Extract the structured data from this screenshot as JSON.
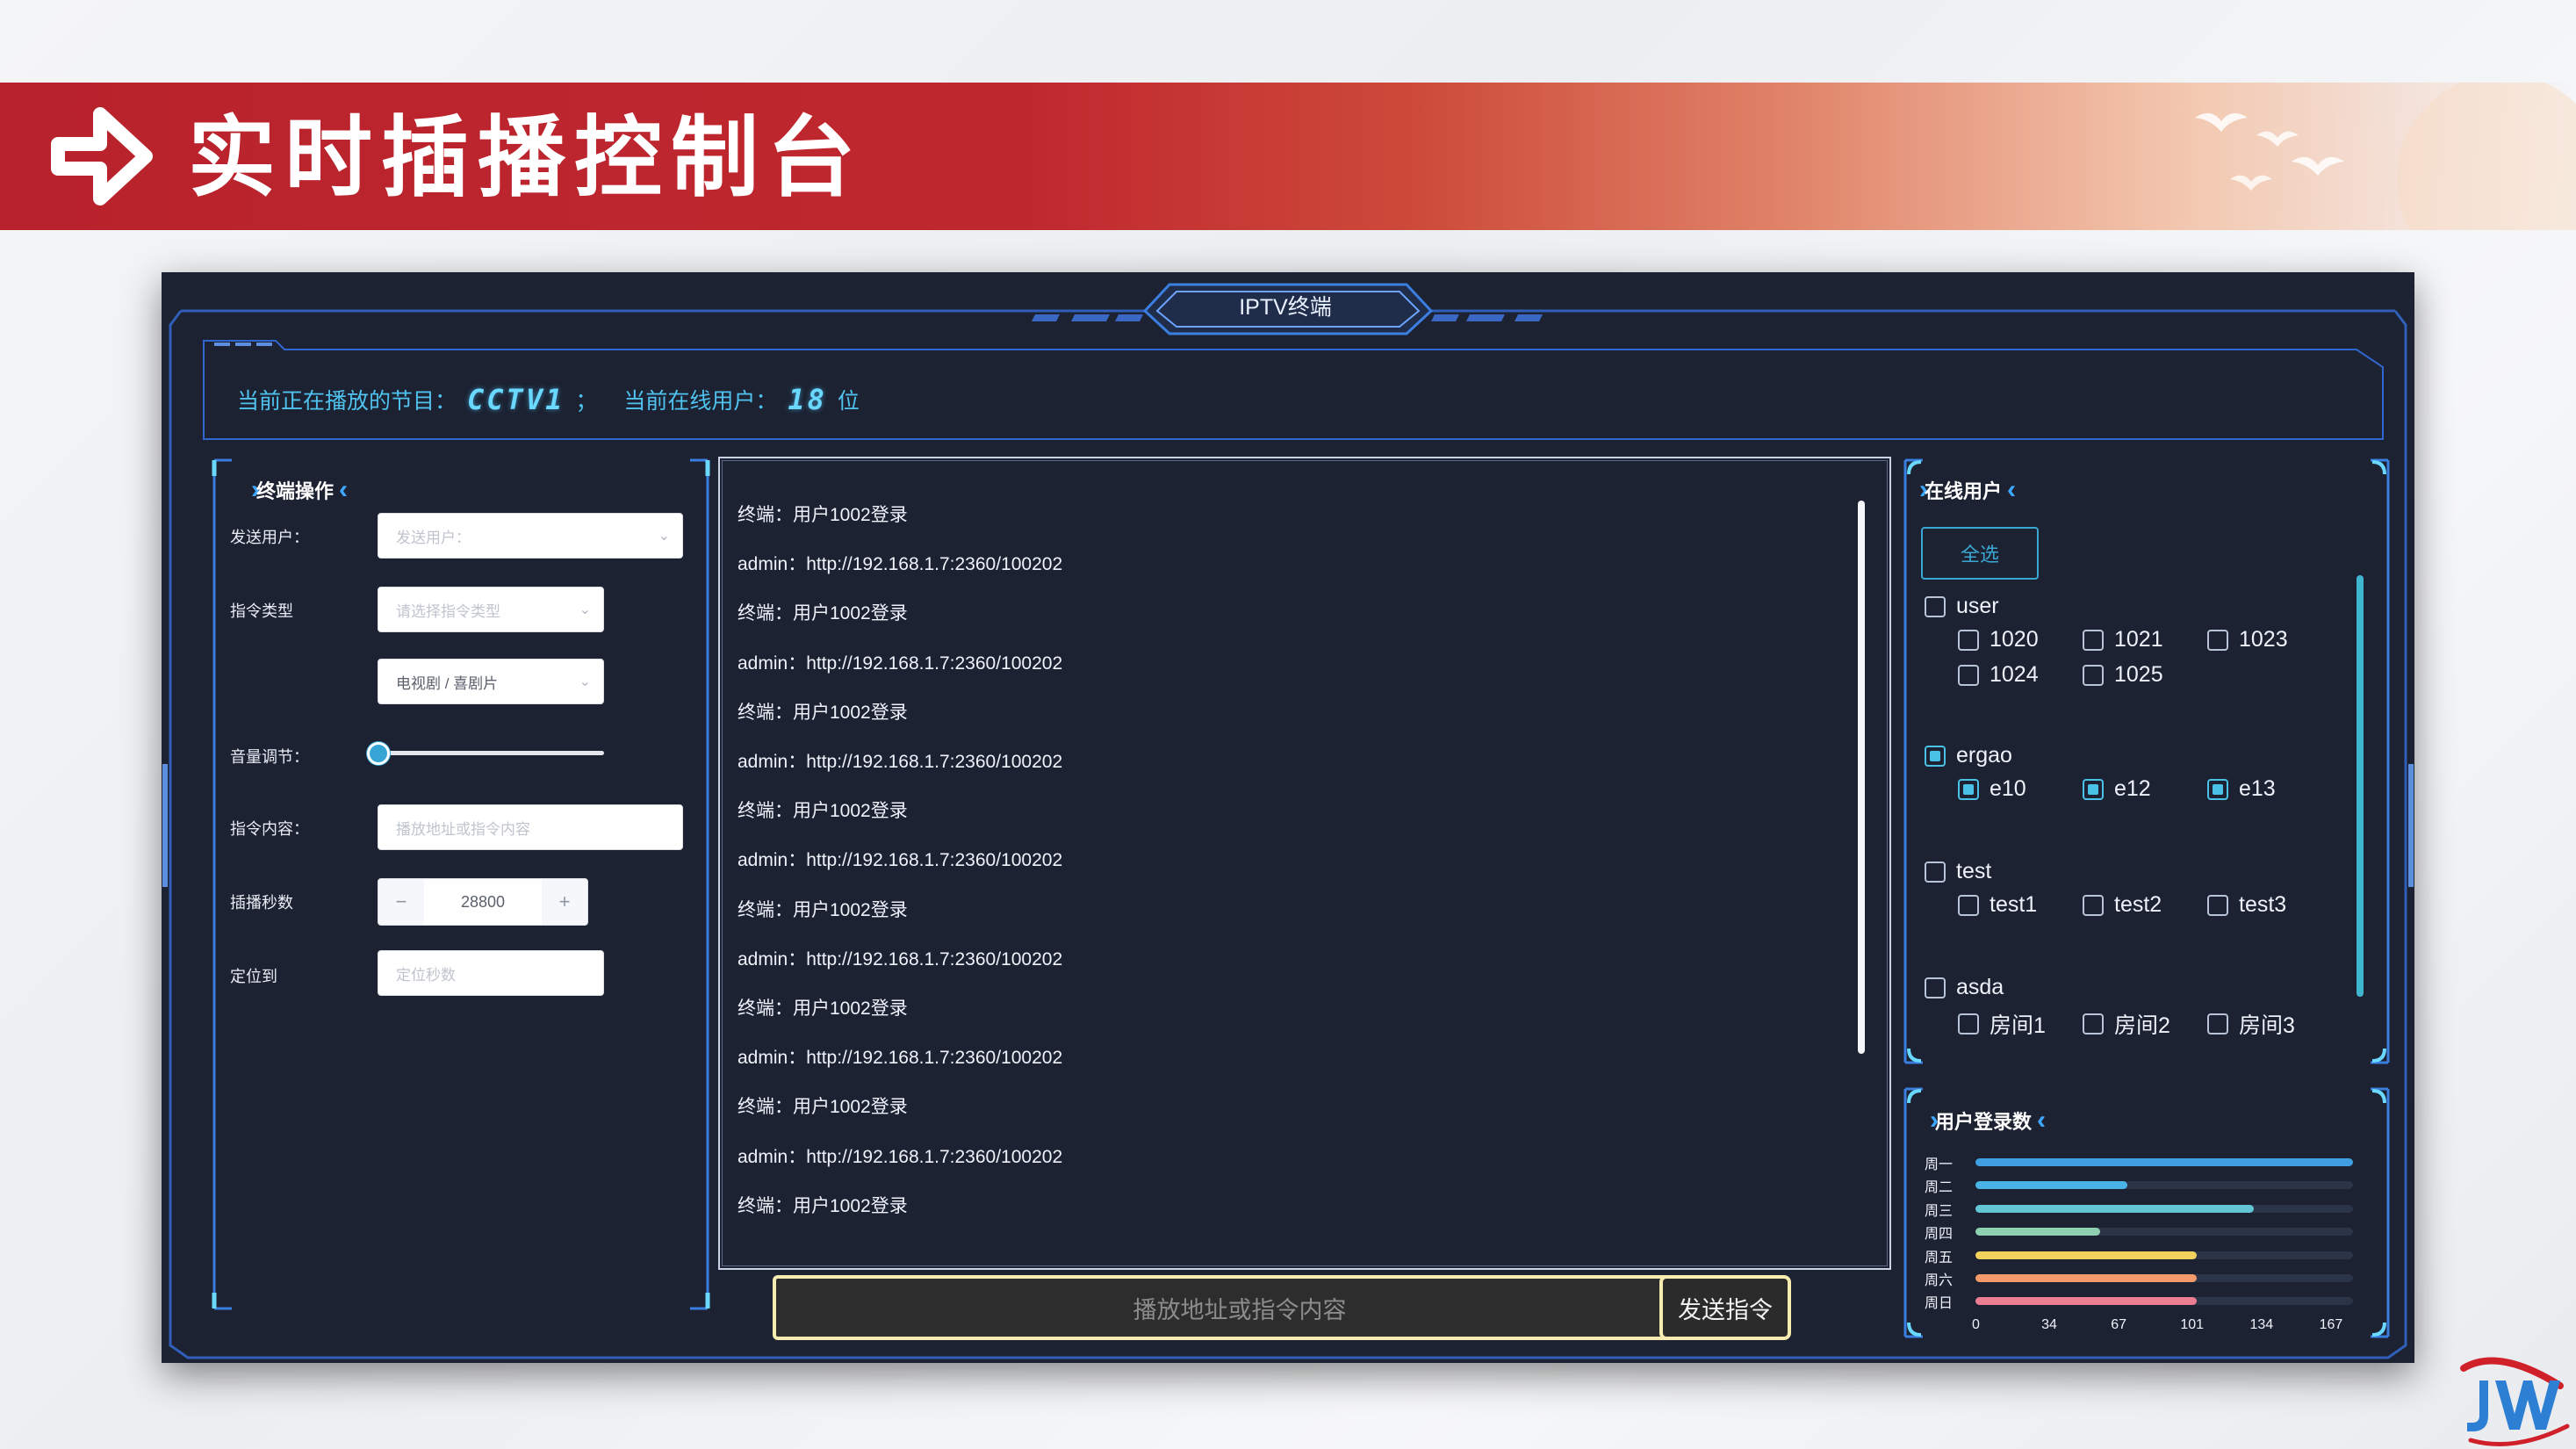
{
  "slide": {
    "title": "实时插播控制台"
  },
  "window": {
    "title": "IPTV终端"
  },
  "status": {
    "program_label": "当前正在播放的节目：",
    "program_value": "CCTV1",
    "separator": "；",
    "users_label": "当前在线用户：",
    "users_value": "18",
    "users_unit": "位"
  },
  "terminal_ops": {
    "heading": "终端操作",
    "send_user_label": "发送用户：",
    "send_user_placeholder": "发送用户：",
    "cmd_type_label": "指令类型",
    "cmd_type_placeholder": "请选择指令类型",
    "cmd_subtype_value": "电视剧 / 喜剧片",
    "volume_label": "音量调节：",
    "volume_value": 0,
    "cmd_content_label": "指令内容：",
    "cmd_content_placeholder": "播放地址或指令内容",
    "insert_seconds_label": "插播秒数",
    "insert_seconds_value": "28800",
    "minus": "−",
    "plus": "+",
    "seek_label": "定位到",
    "seek_placeholder": "定位秒数"
  },
  "log": {
    "lines": [
      "终端：用户1002登录",
      "admin：http://192.168.1.7:2360/100202",
      "终端：用户1002登录",
      "admin：http://192.168.1.7:2360/100202",
      "终端：用户1002登录",
      "admin：http://192.168.1.7:2360/100202",
      "终端：用户1002登录",
      "admin：http://192.168.1.7:2360/100202",
      "终端：用户1002登录",
      "admin：http://192.168.1.7:2360/100202",
      "终端：用户1002登录",
      "admin：http://192.168.1.7:2360/100202",
      "终端：用户1002登录",
      "admin：http://192.168.1.7:2360/100202",
      "终端：用户1002登录"
    ]
  },
  "send": {
    "input_placeholder": "播放地址或指令内容",
    "button_label": "发送指令"
  },
  "online_users": {
    "heading": "在线用户",
    "select_all": "全选",
    "groups": [
      {
        "name": "user",
        "checked": false,
        "members": [
          {
            "name": "1020",
            "checked": false
          },
          {
            "name": "1021",
            "checked": false
          },
          {
            "name": "1023",
            "checked": false
          },
          {
            "name": "1024",
            "checked": false
          },
          {
            "name": "1025",
            "checked": false
          }
        ]
      },
      {
        "name": "ergao",
        "checked": true,
        "members": [
          {
            "name": "e10",
            "checked": true
          },
          {
            "name": "e12",
            "checked": true
          },
          {
            "name": "e13",
            "checked": true
          }
        ]
      },
      {
        "name": "test",
        "checked": false,
        "members": [
          {
            "name": "test1",
            "checked": false
          },
          {
            "name": "test2",
            "checked": false
          },
          {
            "name": "test3",
            "checked": false
          }
        ]
      },
      {
        "name": "asda",
        "checked": false,
        "members": [
          {
            "name": "房间1",
            "checked": false
          },
          {
            "name": "房间2",
            "checked": false
          },
          {
            "name": "房间3",
            "checked": false
          }
        ]
      }
    ]
  },
  "login_chart": {
    "heading": "用户登录数"
  },
  "chart_data": {
    "type": "bar",
    "orientation": "horizontal",
    "title": "用户登录数",
    "categories": [
      "周一",
      "周二",
      "周三",
      "周四",
      "周五",
      "周六",
      "周日"
    ],
    "values": [
      167,
      67,
      123,
      55,
      98,
      98,
      98
    ],
    "colors": [
      "#3f9fe0",
      "#4ab3e6",
      "#62c6d4",
      "#8fd0b0",
      "#f2d15c",
      "#f29a6a",
      "#ec7d93"
    ],
    "xlim": [
      0,
      167
    ],
    "xticks": [
      "0",
      "34",
      "67",
      "101",
      "134",
      "167"
    ],
    "grid": false
  },
  "logo": {
    "text": "JW"
  }
}
